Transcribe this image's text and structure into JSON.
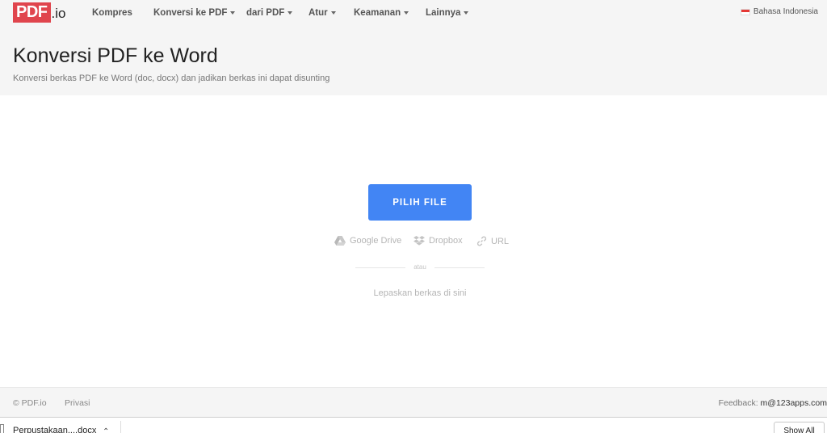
{
  "logo": {
    "brand": "PDF",
    "ext": ".io"
  },
  "nav": {
    "items": [
      {
        "label": "Kompres",
        "dropdown": false
      },
      {
        "label": "Konversi ke PDF",
        "dropdown": true
      },
      {
        "label": "dari PDF",
        "dropdown": true
      },
      {
        "label": "Atur",
        "dropdown": true
      },
      {
        "label": "Keamanan",
        "dropdown": true
      },
      {
        "label": "Lainnya",
        "dropdown": true
      }
    ],
    "language": "Bahasa Indonesia"
  },
  "header": {
    "title": "Konversi PDF ke Word",
    "subtitle": "Konversi berkas PDF ke Word (doc, docx) dan jadikan berkas ini dapat disunting"
  },
  "upload": {
    "button_label": "PILIH FILE",
    "sources": [
      {
        "label": "Google Drive",
        "icon": "google-drive-icon"
      },
      {
        "label": "Dropbox",
        "icon": "dropbox-icon"
      },
      {
        "label": "URL",
        "icon": "link-icon"
      }
    ],
    "or_label": "atau",
    "drop_label": "Lepaskan berkas di sini"
  },
  "footer": {
    "copyright": "© PDF.io",
    "privacy": "Privasi",
    "feedback_label": "Feedback:",
    "feedback_email": "m@123apps.com"
  },
  "download_bar": {
    "file_name": "Perpustakaan....docx",
    "show_all": "Show All"
  },
  "colors": {
    "brand": "#e0454d",
    "primary_button": "#4285f4",
    "header_bg": "#f5f5f5"
  }
}
